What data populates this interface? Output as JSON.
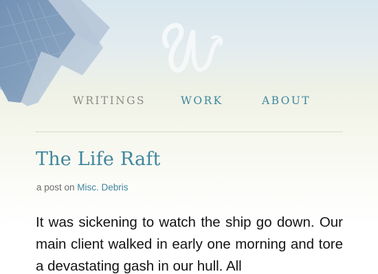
{
  "nav": {
    "items": [
      {
        "label": "WRITINGS"
      },
      {
        "label": "WORK"
      },
      {
        "label": "ABOUT"
      }
    ]
  },
  "post": {
    "title": "The Life Raft",
    "meta_prefix": "a post on ",
    "category": "Misc. Debris",
    "body": "It was sickening to watch the ship go down. Our main client walked in early one morning and tore a devastating gash in our hull. All"
  },
  "colors": {
    "accent": "#3f869d",
    "nav_inactive": "#8b8c83",
    "body_text": "#141414"
  },
  "icons": {
    "logo": "script-w-logo-icon",
    "background": "skyscrapers-illustration"
  }
}
